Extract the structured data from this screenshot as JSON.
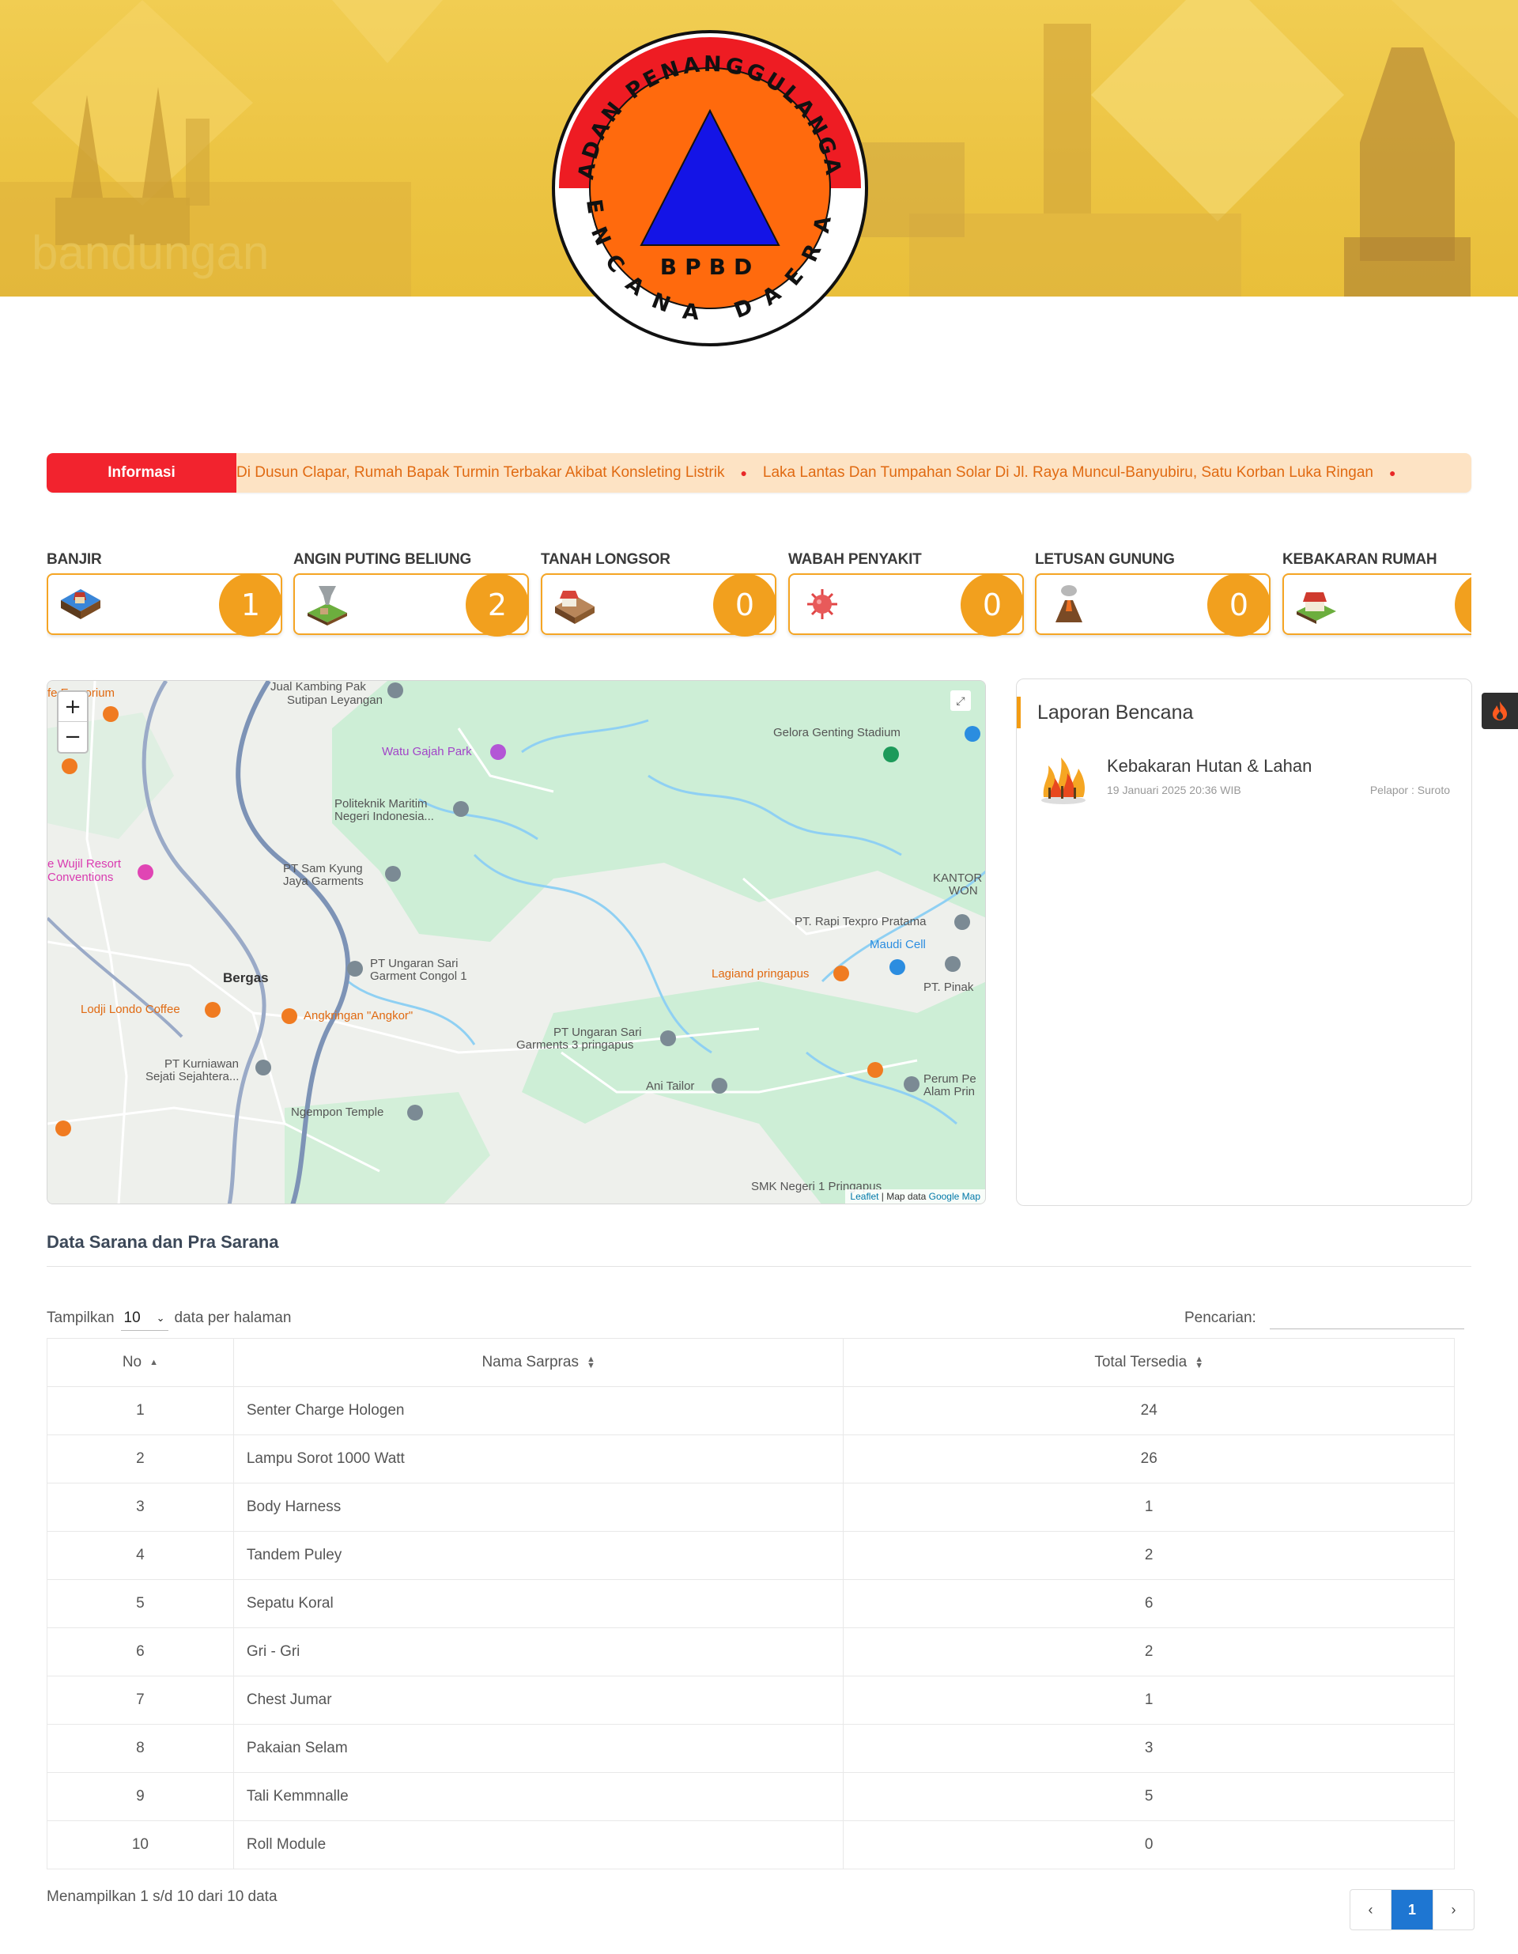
{
  "header": {
    "logo": {
      "ring_top": "BADAN PENANGGULANGAN",
      "ring_bottom": "BENCANA DAERAH",
      "center": "BPBD"
    }
  },
  "ticker": {
    "label": "Informasi",
    "items": [
      "Di Dusun Clapar, Rumah Bapak Turmin Terbakar Akibat Konsleting Listrik",
      "Laka Lantas Dan Tumpahan Solar Di Jl. Raya Muncul-Banyubiru, Satu Korban Luka Ringan"
    ]
  },
  "disasters": [
    {
      "title": "BANJIR",
      "count": "1",
      "icon": "flood-icon"
    },
    {
      "title": "ANGIN PUTING BELIUNG",
      "count": "2",
      "icon": "tornado-icon"
    },
    {
      "title": "TANAH LONGSOR",
      "count": "0",
      "icon": "landslide-icon"
    },
    {
      "title": "WABAH PENYAKIT",
      "count": "0",
      "icon": "virus-icon"
    },
    {
      "title": "LETUSAN GUNUNG",
      "count": "0",
      "icon": "volcano-icon"
    },
    {
      "title": "KEBAKARAN RUMAH",
      "count": "",
      "icon": "house-fire-icon"
    }
  ],
  "map": {
    "zoom_in": "+",
    "zoom_out": "−",
    "attribution_leaflet": "Leaflet",
    "attribution_text": "| Map data",
    "attribution_google": "Google Map",
    "labels": [
      "fe Emporium",
      "Jual Kambing Pak",
      "Sutipan Leyangan",
      "Watu Gajah Park",
      "Gelora Genting Stadium",
      "Politeknik Maritim",
      "Negeri Indonesia...",
      "e Wujil Resort",
      "Conventions",
      "PT Sam Kyung",
      "Jaya Garments",
      "KANTOR",
      "WON",
      "PT. Rapi Texpro Pratama",
      "Maudi Cell",
      "PT. Pinak",
      "PT Ungaran Sari",
      "Garment Congol 1",
      "Bergas",
      "Lagiand pringapus",
      "Lodji Londo Coffee",
      "Angkringan \"Angkor\"",
      "PT Ungaran Sari",
      "Garments 3 pringapus",
      "PT Kurniawan",
      "Sejati Sejahtera...",
      "Ani Tailor",
      "Perum Pe",
      "Alam Prin",
      "Ngempon Temple",
      "SMK Negeri 1 Pringapus"
    ]
  },
  "report": {
    "heading": "Laporan Bencana",
    "items": [
      {
        "title": "Kebakaran Hutan & Lahan",
        "date": "19 Januari 2025 20:36 WIB",
        "pelapor": "Pelapor : Suroto"
      }
    ]
  },
  "sarpras": {
    "title": "Data Sarana dan Pra Sarana",
    "show_prefix": "Tampilkan",
    "show_value": "10",
    "show_suffix": "data per halaman",
    "search_label": "Pencarian:",
    "search_value": "",
    "columns": [
      "No",
      "Nama Sarpras",
      "Total Tersedia"
    ],
    "rows": [
      [
        "1",
        "Senter Charge Hologen",
        "24"
      ],
      [
        "2",
        "Lampu Sorot 1000 Watt",
        "26"
      ],
      [
        "3",
        "Body Harness",
        "1"
      ],
      [
        "4",
        "Tandem Puley",
        "2"
      ],
      [
        "5",
        "Sepatu Koral",
        "6"
      ],
      [
        "6",
        "Gri - Gri",
        "2"
      ],
      [
        "7",
        "Chest Jumar",
        "1"
      ],
      [
        "8",
        "Pakaian Selam",
        "3"
      ],
      [
        "9",
        "Tali Kemmnalle",
        "5"
      ],
      [
        "10",
        "Roll Module",
        "0"
      ]
    ],
    "info": "Menampilkan 1 s/d 10 dari 10 data",
    "pager": {
      "prev": "‹",
      "current": "1",
      "next": "›"
    }
  },
  "colors": {
    "accent": "#f2a01e",
    "ticker_label": "#f2232e",
    "ticker_bg": "#fde3c4",
    "ticker_text": "#e06a12",
    "pager_active": "#1e76d2"
  }
}
